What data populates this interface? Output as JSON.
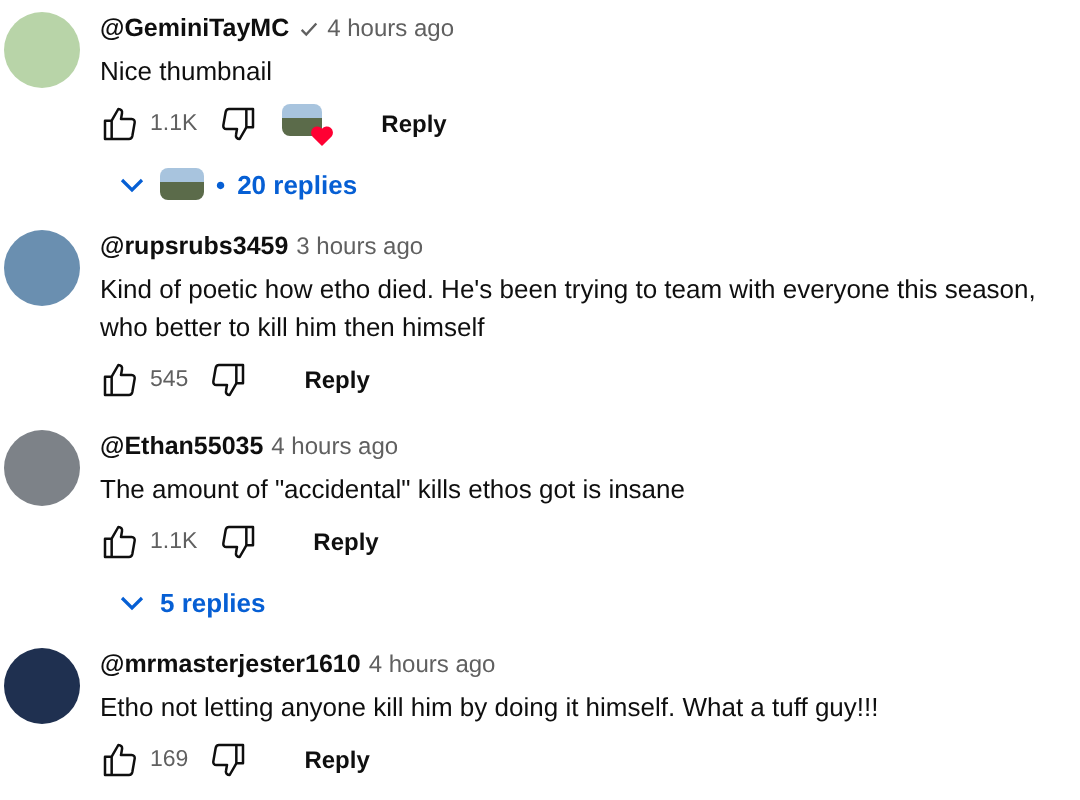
{
  "comments": [
    {
      "author": "@GeminiTayMC",
      "verified": true,
      "time": "4 hours ago",
      "text": "Nice thumbnail",
      "likes": "1.1K",
      "creator_hearted": true,
      "reply_label": "Reply",
      "replies": {
        "label": "20 replies",
        "creator_replied": true,
        "separator": "•"
      }
    },
    {
      "author": "@rupsrubs3459",
      "verified": false,
      "time": "3 hours ago",
      "text": "Kind of poetic how etho died. He's been trying to team with everyone this season, who better to kill him then himself",
      "likes": "545",
      "creator_hearted": false,
      "reply_label": "Reply"
    },
    {
      "author": "@Ethan55035",
      "verified": false,
      "time": "4 hours ago",
      "text": "The amount of \"accidental\" kills ethos got is insane",
      "likes": "1.1K",
      "creator_hearted": false,
      "reply_label": "Reply",
      "replies": {
        "label": "5 replies",
        "creator_replied": false
      }
    },
    {
      "author": "@mrmasterjester1610",
      "verified": false,
      "time": "4 hours ago",
      "text": "Etho not letting anyone kill him by doing it himself. What a tuff guy!!!",
      "likes": "169",
      "creator_hearted": false,
      "reply_label": "Reply"
    }
  ]
}
